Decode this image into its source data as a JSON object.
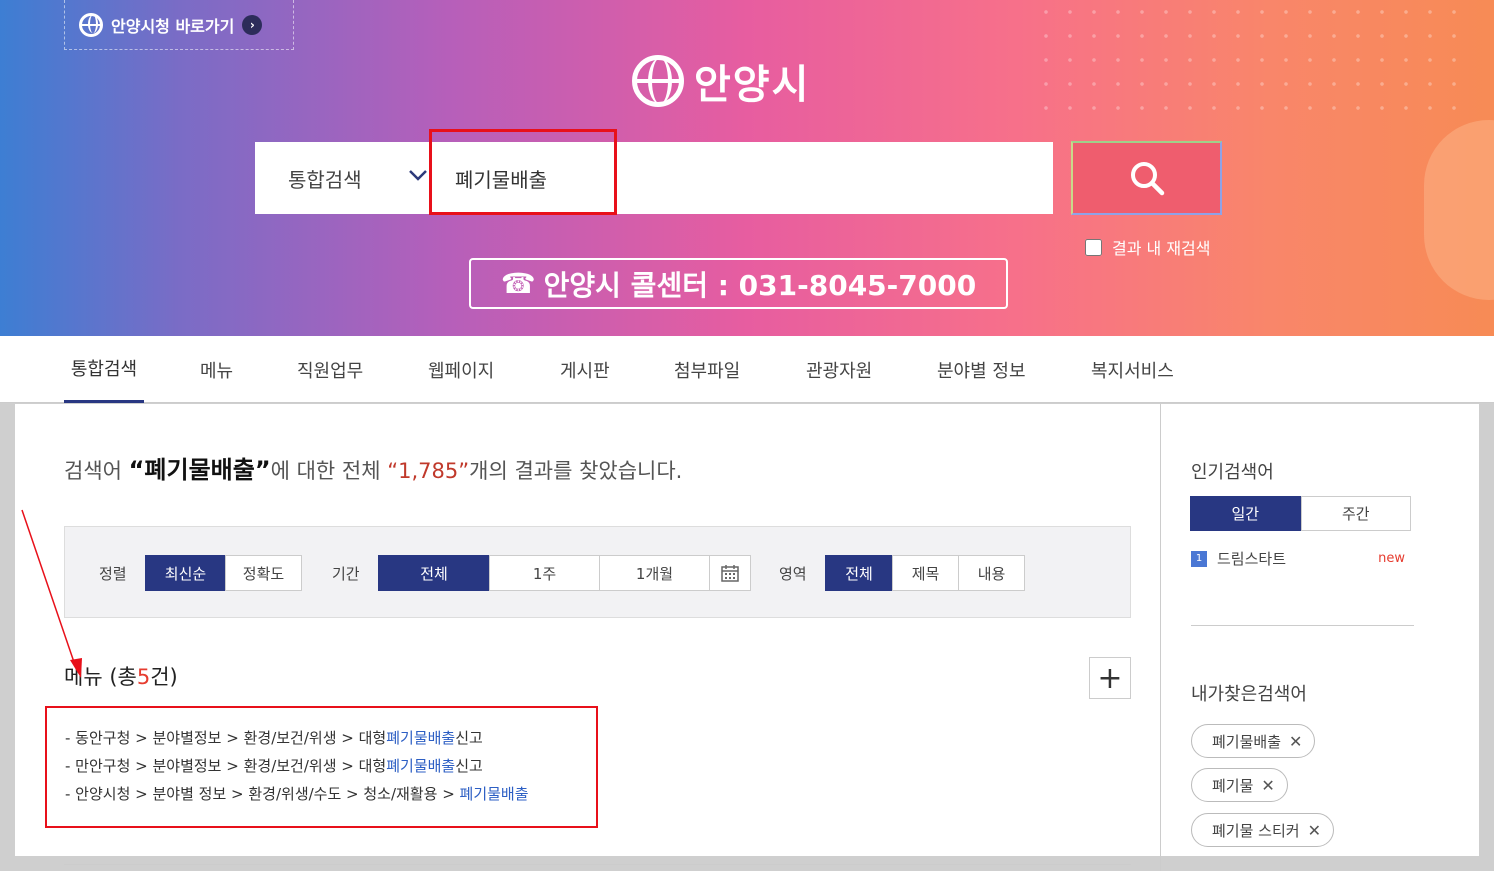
{
  "header": {
    "shortcut_label": "안양시청 바로가기",
    "logo_text": "안양시",
    "search_category": "통합검색",
    "search_value": "폐기물배출",
    "re_search_label": "결과 내 재검색",
    "callcenter": "안양시 콜센터 : 031-8045-7000"
  },
  "tabs": [
    "통합검색",
    "메뉴",
    "직원업무",
    "웹페이지",
    "게시판",
    "첨부파일",
    "관광자원",
    "분야별 정보",
    "복지서비스"
  ],
  "result": {
    "prefix": "검색어 ",
    "keyword": "“폐기물배출”",
    "middle": "에 대한 전체 ",
    "count": "“1,785”",
    "suffix": "개의 결과를 찾았습니다."
  },
  "filters": {
    "sort_label": "정렬",
    "sort_options": [
      "최신순",
      "정확도"
    ],
    "period_label": "기간",
    "period_options": [
      "전체",
      "1주",
      "1개월"
    ],
    "area_label": "영역",
    "area_options": [
      "전체",
      "제목",
      "내용"
    ]
  },
  "menu_section": {
    "title_prefix": "메뉴 (총",
    "count": "5",
    "title_suffix": "건)",
    "items": [
      {
        "path": "-  동안구청 > 분야별정보 > 환경/보건/위생 > 대형",
        "hl": "폐기물배출",
        "tail": "신고"
      },
      {
        "path": "-  만안구청 > 분야별정보 > 환경/보건/위생 > 대형",
        "hl": "폐기물배출",
        "tail": "신고"
      },
      {
        "path": "-  안양시청 > 분야별 정보 > 환경/위생/수도 > 청소/재활용 > ",
        "hl": "폐기물배출",
        "tail": ""
      }
    ]
  },
  "sidebar": {
    "popular_title": "인기검색어",
    "popular_tabs": [
      "일간",
      "주간"
    ],
    "popular_items": [
      {
        "rank": "1",
        "term": "드림스타트",
        "badge": "new"
      }
    ],
    "my_title": "내가찾은검색어",
    "my_terms": [
      "폐기물배출",
      "폐기물",
      "폐기물 스티커"
    ]
  },
  "colors": {
    "accent": "#283782",
    "highlight_link": "#2d5fc4",
    "count_red": "#e63c2f",
    "annotation_red": "#e8101a"
  }
}
